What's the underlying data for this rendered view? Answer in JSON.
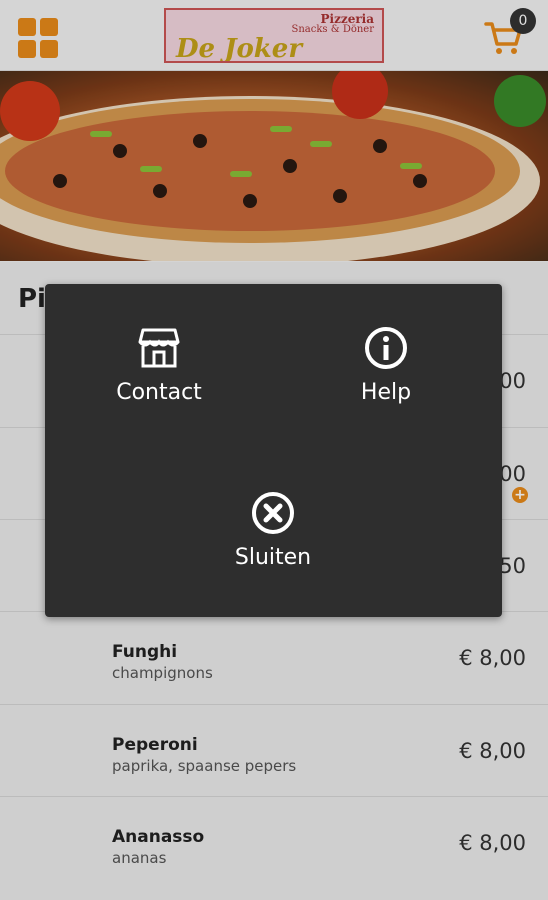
{
  "header": {
    "logo_line1": "Pizzeria",
    "logo_line2": "Snacks & Döner",
    "logo_line3": "De Joker",
    "cart_count": "0",
    "icons": {
      "menu": "grid-icon",
      "cart": "cart-icon"
    }
  },
  "category": {
    "title": "Pi"
  },
  "menu_items": [
    {
      "price": "00"
    },
    {
      "price": "00"
    },
    {
      "price": "50"
    },
    {
      "name": "Funghi",
      "desc": "champignons",
      "price": "€ 8,00"
    },
    {
      "name": "Peperoni",
      "desc": "paprika, spaanse pepers",
      "price": "€ 8,00"
    },
    {
      "name": "Ananasso",
      "desc": "ananas",
      "price": "€ 8,00"
    }
  ],
  "modal": {
    "contact_label": "Contact",
    "help_label": "Help",
    "close_label": "Sluiten",
    "icons": {
      "contact": "store-icon",
      "help": "info-icon",
      "close": "close-circle-icon"
    }
  },
  "colors": {
    "accent": "#e88a1a",
    "modal_bg": "#2e2e2e"
  }
}
